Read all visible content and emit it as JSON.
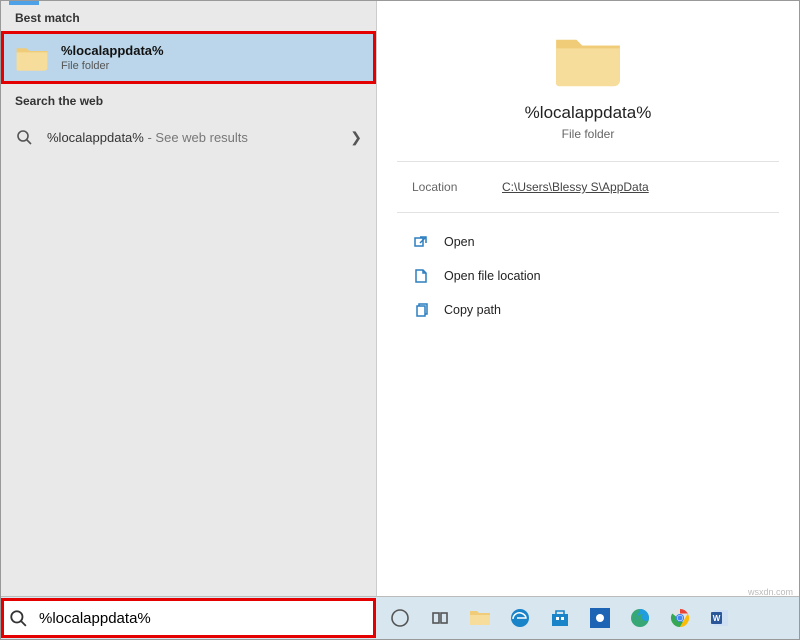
{
  "left": {
    "best_match_label": "Best match",
    "result": {
      "title": "%localappdata%",
      "subtitle": "File folder"
    },
    "web_label": "Search the web",
    "web_result": {
      "query": "%localappdata%",
      "suffix": " - See web results"
    }
  },
  "preview": {
    "title": "%localappdata%",
    "subtitle": "File folder",
    "location_label": "Location",
    "location_path": "C:\\Users\\Blessy S\\AppData"
  },
  "actions": {
    "open": "Open",
    "open_location": "Open file location",
    "copy_path": "Copy path"
  },
  "search_box": {
    "value": "%localappdata%"
  },
  "watermark": "wsxdn.com"
}
